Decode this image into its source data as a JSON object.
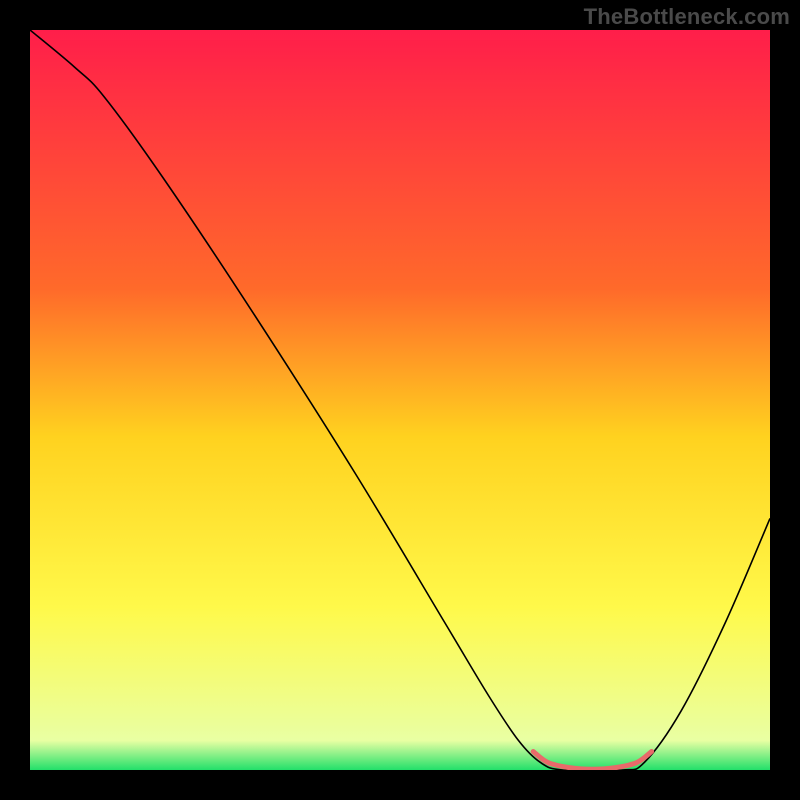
{
  "watermark": "TheBottleneck.com",
  "chart_data": {
    "type": "line",
    "title": "",
    "xlabel": "",
    "ylabel": "",
    "ylim": [
      0,
      100
    ],
    "gradient_stops": [
      {
        "offset": 0,
        "color": "#ff1e4a"
      },
      {
        "offset": 35,
        "color": "#ff6a2a"
      },
      {
        "offset": 55,
        "color": "#ffd21f"
      },
      {
        "offset": 78,
        "color": "#fff94a"
      },
      {
        "offset": 96,
        "color": "#e9ffa3"
      },
      {
        "offset": 100,
        "color": "#22e06a"
      }
    ],
    "series": [
      {
        "name": "bottleneck-curve",
        "stroke": "#000000",
        "stroke_width": 1.6,
        "points": [
          {
            "x": 0,
            "y": 100
          },
          {
            "x": 6,
            "y": 95
          },
          {
            "x": 10,
            "y": 91
          },
          {
            "x": 18,
            "y": 80
          },
          {
            "x": 30,
            "y": 62
          },
          {
            "x": 44,
            "y": 40
          },
          {
            "x": 56,
            "y": 20
          },
          {
            "x": 62,
            "y": 10
          },
          {
            "x": 66,
            "y": 4
          },
          {
            "x": 69,
            "y": 1
          },
          {
            "x": 72,
            "y": 0
          },
          {
            "x": 80,
            "y": 0
          },
          {
            "x": 83,
            "y": 1
          },
          {
            "x": 88,
            "y": 8
          },
          {
            "x": 94,
            "y": 20
          },
          {
            "x": 100,
            "y": 34
          }
        ]
      },
      {
        "name": "valley-highlight",
        "stroke": "#e86a6a",
        "stroke_width": 5,
        "points": [
          {
            "x": 68,
            "y": 2.5
          },
          {
            "x": 70,
            "y": 1.0
          },
          {
            "x": 73,
            "y": 0.3
          },
          {
            "x": 76,
            "y": 0.1
          },
          {
            "x": 79,
            "y": 0.3
          },
          {
            "x": 82,
            "y": 1.0
          },
          {
            "x": 84,
            "y": 2.5
          }
        ]
      }
    ]
  }
}
